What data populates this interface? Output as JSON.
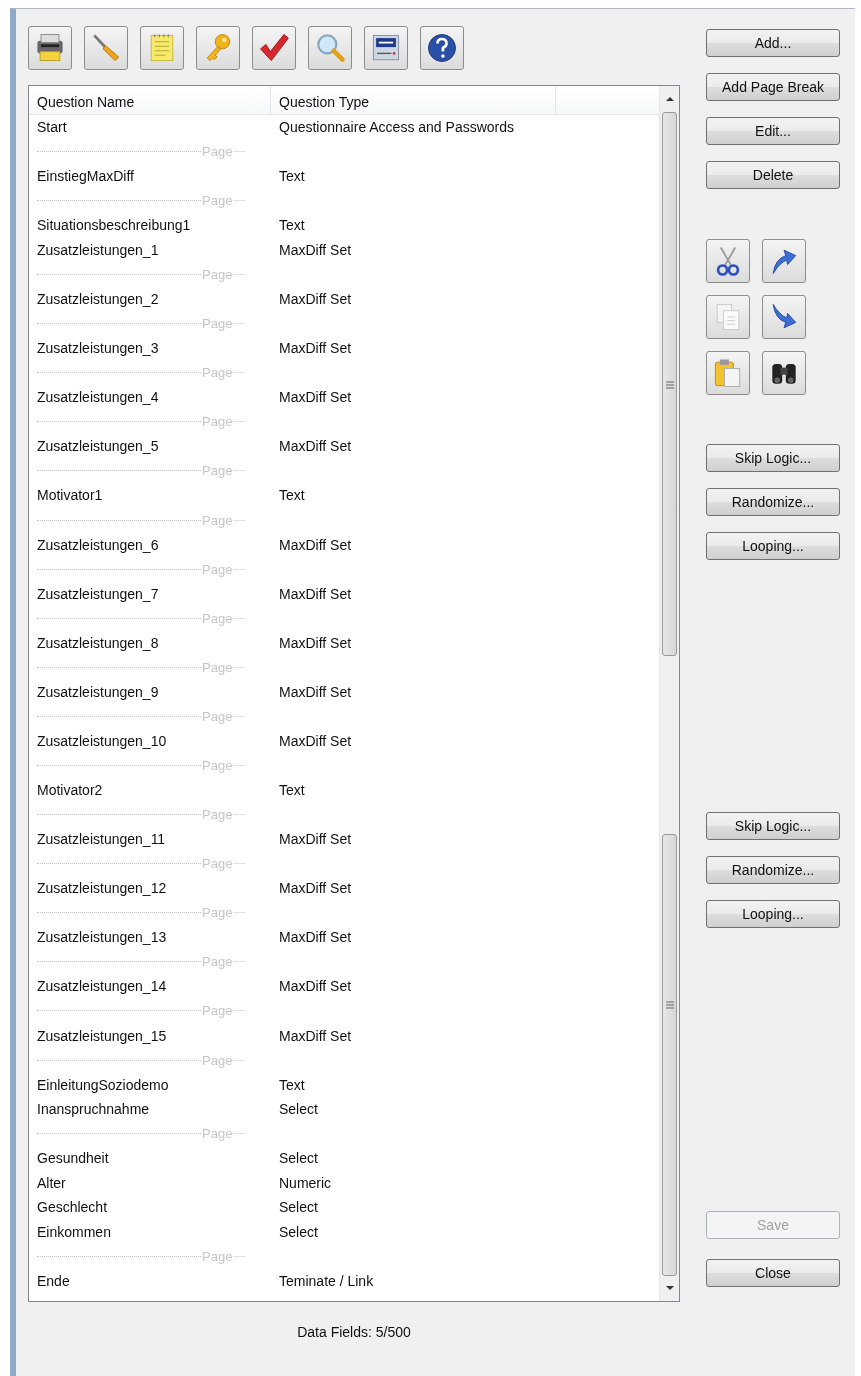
{
  "list": {
    "columns": [
      "Question Name",
      "Question Type"
    ],
    "rows": [
      {
        "kind": "question",
        "name": "Start",
        "type": "Questionnaire Access and Passwords"
      },
      {
        "kind": "page_break",
        "label": "Page"
      },
      {
        "kind": "question",
        "name": "EinstiegMaxDiff",
        "type": "Text"
      },
      {
        "kind": "page_break",
        "label": "Page"
      },
      {
        "kind": "question",
        "name": "Situationsbeschreibung1",
        "type": "Text"
      },
      {
        "kind": "question",
        "name": "Zusatzleistungen_1",
        "type": "MaxDiff Set"
      },
      {
        "kind": "page_break",
        "label": "Page"
      },
      {
        "kind": "question",
        "name": "Zusatzleistungen_2",
        "type": "MaxDiff Set"
      },
      {
        "kind": "page_break",
        "label": "Page"
      },
      {
        "kind": "question",
        "name": "Zusatzleistungen_3",
        "type": "MaxDiff Set"
      },
      {
        "kind": "page_break",
        "label": "Page"
      },
      {
        "kind": "question",
        "name": "Zusatzleistungen_4",
        "type": "MaxDiff Set"
      },
      {
        "kind": "page_break",
        "label": "Page"
      },
      {
        "kind": "question",
        "name": "Zusatzleistungen_5",
        "type": "MaxDiff Set"
      },
      {
        "kind": "page_break",
        "label": "Page"
      },
      {
        "kind": "question",
        "name": "Motivator1",
        "type": "Text"
      },
      {
        "kind": "page_break",
        "label": "Page"
      },
      {
        "kind": "question",
        "name": "Zusatzleistungen_6",
        "type": "MaxDiff Set"
      },
      {
        "kind": "page_break",
        "label": "Page"
      },
      {
        "kind": "question",
        "name": "Zusatzleistungen_7",
        "type": "MaxDiff Set"
      },
      {
        "kind": "page_break",
        "label": "Page"
      },
      {
        "kind": "question",
        "name": "Zusatzleistungen_8",
        "type": "MaxDiff Set"
      },
      {
        "kind": "page_break",
        "label": "Page"
      },
      {
        "kind": "question",
        "name": "Zusatzleistungen_9",
        "type": "MaxDiff Set"
      },
      {
        "kind": "page_break",
        "label": "Page"
      },
      {
        "kind": "question",
        "name": "Zusatzleistungen_10",
        "type": "MaxDiff Set"
      },
      {
        "kind": "page_break",
        "label": "Page"
      },
      {
        "kind": "question",
        "name": "Motivator2",
        "type": "Text"
      },
      {
        "kind": "page_break",
        "label": "Page"
      },
      {
        "kind": "question",
        "name": "Zusatzleistungen_11",
        "type": "MaxDiff Set"
      },
      {
        "kind": "page_break",
        "label": "Page"
      },
      {
        "kind": "question",
        "name": "Zusatzleistungen_12",
        "type": "MaxDiff Set"
      },
      {
        "kind": "page_break",
        "label": "Page"
      },
      {
        "kind": "question",
        "name": "Zusatzleistungen_13",
        "type": "MaxDiff Set"
      },
      {
        "kind": "page_break",
        "label": "Page"
      },
      {
        "kind": "question",
        "name": "Zusatzleistungen_14",
        "type": "MaxDiff Set"
      },
      {
        "kind": "page_break",
        "label": "Page"
      },
      {
        "kind": "question",
        "name": "Zusatzleistungen_15",
        "type": "MaxDiff Set"
      },
      {
        "kind": "page_break",
        "label": "Page"
      },
      {
        "kind": "question",
        "name": "EinleitungSoziodemo",
        "type": "Text"
      },
      {
        "kind": "question",
        "name": "Inanspruchnahme",
        "type": "Select"
      },
      {
        "kind": "page_break",
        "label": "Page"
      },
      {
        "kind": "question",
        "name": "Gesundheit",
        "type": "Select"
      },
      {
        "kind": "question",
        "name": "Alter",
        "type": "Numeric"
      },
      {
        "kind": "question",
        "name": "Geschlecht",
        "type": "Select"
      },
      {
        "kind": "question",
        "name": "Einkommen",
        "type": "Select"
      },
      {
        "kind": "page_break",
        "label": "Page"
      },
      {
        "kind": "question",
        "name": "Ende",
        "type": "Teminate / Link"
      }
    ]
  },
  "edit_buttons": [
    "Add...",
    "Add Page Break",
    "Edit...",
    "Delete"
  ],
  "logic_buttons_upper": [
    "Skip Logic...",
    "Randomize...",
    "Looping..."
  ],
  "logic_buttons_lower": [
    "Skip Logic...",
    "Randomize...",
    "Looping..."
  ],
  "dialog_buttons": [
    {
      "label": "Save",
      "disabled": true
    },
    {
      "label": "Close",
      "disabled": false
    }
  ],
  "status": "Data Fields: 5/500"
}
